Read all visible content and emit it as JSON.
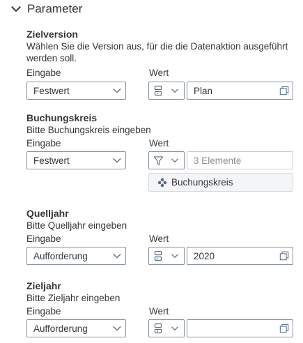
{
  "header": {
    "title": "Parameter"
  },
  "sections": [
    {
      "title": "Zielversion",
      "description": "Wählen Sie die Version aus, für die die Datenaktion ausgeführt werden soll.",
      "input_label": "Eingabe",
      "value_label": "Wert",
      "input_value": "Festwert",
      "type_icon": "member-list-icon",
      "value": "Plan"
    },
    {
      "title": "Buchungskreis",
      "description": "Bitte Buchungskreis eingeben",
      "input_label": "Eingabe",
      "value_label": "Wert",
      "input_value": "Festwert",
      "type_icon": "filter-icon",
      "value": "3 Elemente",
      "member_button_label": "Buchungskreis",
      "member_button_icon": "dimension-icon"
    },
    {
      "title": "Quelljahr",
      "description": "Bitte Quelljahr eingeben",
      "input_label": "Eingabe",
      "value_label": "Wert",
      "input_value": "Aufforderung",
      "type_icon": "member-list-icon",
      "value": "2020"
    },
    {
      "title": "Zieljahr",
      "description": "Bitte Zieljahr eingeben",
      "input_label": "Eingabe",
      "value_label": "Wert",
      "input_value": "Aufforderung",
      "type_icon": "member-list-icon",
      "value": ""
    }
  ],
  "colors": {
    "text": "#32363a",
    "border": "#89919a",
    "icon": "#556b82"
  }
}
